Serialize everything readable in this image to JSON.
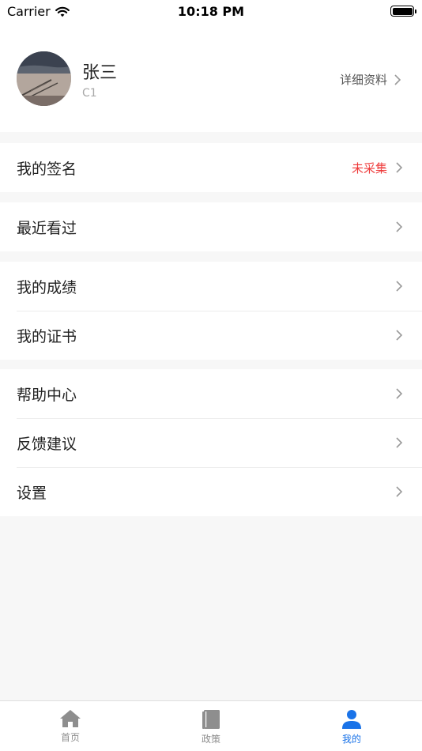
{
  "status_bar": {
    "carrier": "Carrier",
    "time": "10:18 PM"
  },
  "profile": {
    "name": "张三",
    "subtitle": "C1",
    "detail_label": "详细资料"
  },
  "menu": {
    "signature": {
      "label": "我的签名",
      "status": "未采集"
    },
    "recent": {
      "label": "最近看过"
    },
    "scores": {
      "label": "我的成绩"
    },
    "certificates": {
      "label": "我的证书"
    },
    "help": {
      "label": "帮助中心"
    },
    "feedback": {
      "label": "反馈建议"
    },
    "settings": {
      "label": "设置"
    }
  },
  "tabbar": {
    "tabs": [
      {
        "label": "首页",
        "icon": "home-icon"
      },
      {
        "label": "政策",
        "icon": "book-icon"
      },
      {
        "label": "我的",
        "icon": "person-icon"
      }
    ],
    "active_index": 2,
    "active_color": "#1a73e8",
    "inactive_color": "#8e8e8e"
  },
  "colors": {
    "status_alert": "#ee3a3a",
    "background": "#f7f7f7"
  }
}
